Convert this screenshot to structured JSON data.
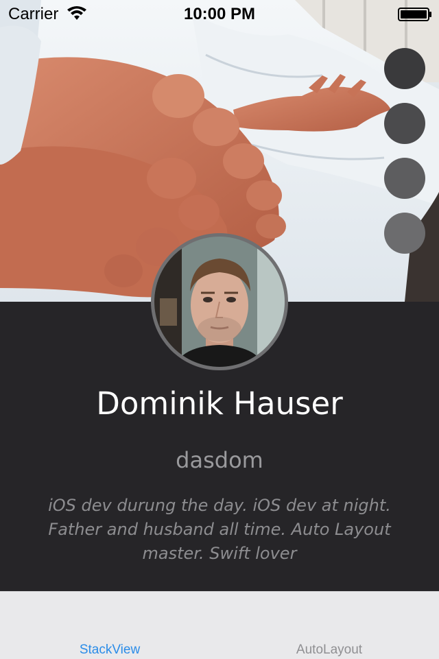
{
  "status_bar": {
    "carrier": "Carrier",
    "time": "10:00 PM",
    "icons": [
      "wifi-icon",
      "battery-icon"
    ]
  },
  "header": {
    "image": "bed-photo-feet-hands"
  },
  "action_buttons": [
    {
      "name": "action-circle-1",
      "color": "#3a3a3c"
    },
    {
      "name": "action-circle-2",
      "color": "#4b4b4d"
    },
    {
      "name": "action-circle-3",
      "color": "#5d5d5f"
    },
    {
      "name": "action-circle-4",
      "color": "#6c6c6e"
    }
  ],
  "profile": {
    "name": "Dominik Hauser",
    "username": "dasdom",
    "bio": "iOS dev durung the day. iOS dev at night. Father and husband all time. Auto Layout master. Swift lover"
  },
  "tab_bar": {
    "tabs": [
      {
        "label": "StackView",
        "selected": true
      },
      {
        "label": "AutoLayout",
        "selected": false
      }
    ],
    "selected_color": "#2a8ce8",
    "unselected_color": "#8f8f92"
  },
  "colors": {
    "profile_background": "#262528",
    "tab_background": "#e9e9eb"
  }
}
